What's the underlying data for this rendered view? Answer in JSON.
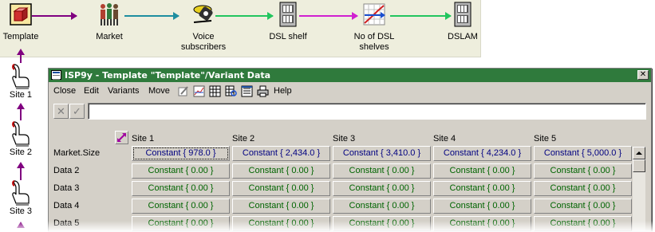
{
  "diagram": {
    "nodes": [
      {
        "label": "Template",
        "icon": "template-cube-icon"
      },
      {
        "label": "Market",
        "icon": "people-icon"
      },
      {
        "label": "Voice subscribers",
        "icon": "telephone-icon"
      },
      {
        "label": "DSL shelf",
        "icon": "equipment-rack-icon"
      },
      {
        "label": "No of DSL shelves",
        "icon": "graph-icon"
      },
      {
        "label": "DSLAM",
        "icon": "equipment-rack-icon"
      }
    ],
    "colors": {
      "link_purple": "#800080",
      "link_teal": "#1e8ea0",
      "link_green": "#22c55e",
      "background": "#eeeedd"
    }
  },
  "sites": [
    {
      "label": "Site 1",
      "icon": "hand-pointer-icon"
    },
    {
      "label": "Site 2",
      "icon": "hand-pointer-icon"
    },
    {
      "label": "Site 3",
      "icon": "hand-pointer-icon"
    }
  ],
  "window": {
    "title": "ISP9y - Template \"Template\"/Variant Data",
    "title_bar_color": "#2f7a3c",
    "close_label": "✕",
    "menu": [
      {
        "label": "Close",
        "accel": "C"
      },
      {
        "label": "Edit",
        "accel": "E"
      },
      {
        "label": "Variants",
        "accel": "r"
      },
      {
        "label": "Move",
        "accel": "M"
      },
      {
        "label": "Help",
        "accel": "H"
      }
    ],
    "toolbar_icons": [
      "edit-icon",
      "chart-icon",
      "table-icon",
      "find-icon",
      "list-icon",
      "print-icon"
    ],
    "edit_cancel": "✕",
    "edit_accept": "✓",
    "edit_value": "",
    "columns": [
      "Site 1",
      "Site 2",
      "Site 3",
      "Site 4",
      "Site 5"
    ],
    "rows": [
      {
        "label": "Market.Size",
        "cells": [
          "Constant { 978.0 }",
          "Constant { 2,434.0 }",
          "Constant { 3,410.0 }",
          "Constant { 4,234.0 }",
          "Constant { 5,000.0 }"
        ]
      },
      {
        "label": "Data 2",
        "cells": [
          "Constant { 0.00 }",
          "Constant { 0.00 }",
          "Constant { 0.00 }",
          "Constant { 0.00 }",
          "Constant { 0.00 }"
        ]
      },
      {
        "label": "Data 3",
        "cells": [
          "Constant { 0.00 }",
          "Constant { 0.00 }",
          "Constant { 0.00 }",
          "Constant { 0.00 }",
          "Constant { 0.00 }"
        ]
      },
      {
        "label": "Data 4",
        "cells": [
          "Constant { 0.00 }",
          "Constant { 0.00 }",
          "Constant { 0.00 }",
          "Constant { 0.00 }",
          "Constant { 0.00 }"
        ]
      },
      {
        "label": "Data 5",
        "cells": [
          "Constant { 0.00 }",
          "Constant { 0.00 }",
          "Constant { 0.00 }",
          "Constant { 0.00 }",
          "Constant { 0.00 }"
        ]
      }
    ],
    "value_colors": {
      "market_size": "#000080",
      "data": "#006400"
    }
  }
}
